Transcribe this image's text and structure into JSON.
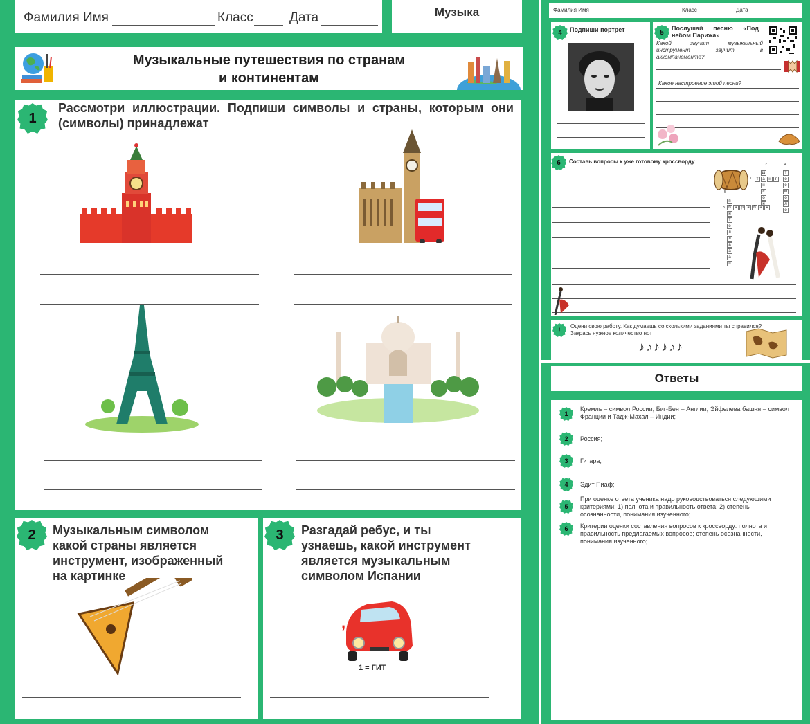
{
  "left": {
    "header": {
      "name_label": "Фамилия Имя",
      "class_label": "Класс",
      "date_label": "Дата",
      "subject": "Музыка"
    },
    "title_line1": "Музыкальные путешествия по странам",
    "title_line2": "и континентам",
    "task1": {
      "number": "1",
      "text": "Рассмотри иллюстрации. Подпиши символы и страны, которым они (символы) принадлежат"
    },
    "task2": {
      "number": "2",
      "lines": [
        "Музыкальным символом",
        "какой страны является",
        "инструмент, изображенный",
        "на картинке"
      ]
    },
    "task3": {
      "number": "3",
      "lines": [
        "Разгадай ребус, и ты",
        "узнаешь, какой инструмент",
        "является музыкальным",
        "символом Испании"
      ],
      "rebus_hint": "1 = ГИТ"
    }
  },
  "right": {
    "header": {
      "name_label": "Фамилия Имя",
      "class_label": "Класс",
      "date_label": "Дата"
    },
    "task4": {
      "number": "4",
      "title": "Подпиши портрет"
    },
    "task5": {
      "number": "5",
      "title": "Послушай песню «Под небом Парижа»",
      "q1": "Какой звучит музыкальный инструмент звучит в аккомпанементе?",
      "q2": "Какое настроение этой песни?"
    },
    "task6": {
      "number": "6",
      "title": "Составь вопросы к уже готовому кроссворду",
      "crossword_numbers": [
        "1",
        "2",
        "3",
        "4",
        "5"
      ],
      "word_tango": [
        "т",
        "а",
        "н",
        "г",
        "о"
      ],
      "word_baraban": [
        "б",
        "а",
        "р",
        "а",
        "б",
        "а",
        "н"
      ],
      "word_vertical_1": [
        "ш",
        "а",
        "н",
        "с",
        "о",
        "н"
      ],
      "word_vertical_2": [
        "п",
        "а",
        "н",
        "т",
        "е",
        "л",
        "л",
        "а"
      ],
      "word_vertical_3": [
        "т",
        "р",
        "е",
        "м",
        "о",
        "л",
        "о"
      ]
    },
    "self_check": {
      "mark": "!",
      "text": "Оцени свою работу. Как думаешь со сколькими заданиями ты справился? Закрась нужное количество нот",
      "notes": "♪♪♪♪♪♪"
    },
    "answers": {
      "title": "Ответы",
      "items": [
        {
          "n": "1",
          "text": "Кремль – символ России, Биг-Бен – Англии, Эйфелева башня – символ Франции и Тадж-Махал – Индии;"
        },
        {
          "n": "2",
          "text": "Россия;"
        },
        {
          "n": "3",
          "text": "Гитара;"
        },
        {
          "n": "4",
          "text": "Эдит Пиаф;"
        },
        {
          "n": "5",
          "text": "При оценке ответа ученика надо руководствоваться следующими критериями: 1) полнота и правильность ответа; 2) степень осознанности, понимания изученного;"
        },
        {
          "n": "6",
          "text": "Критерии оценки составления вопросов к кроссворду: полнота и правильность предлагаемых вопросов; степень осознанности, понимания изученного;"
        }
      ]
    }
  }
}
